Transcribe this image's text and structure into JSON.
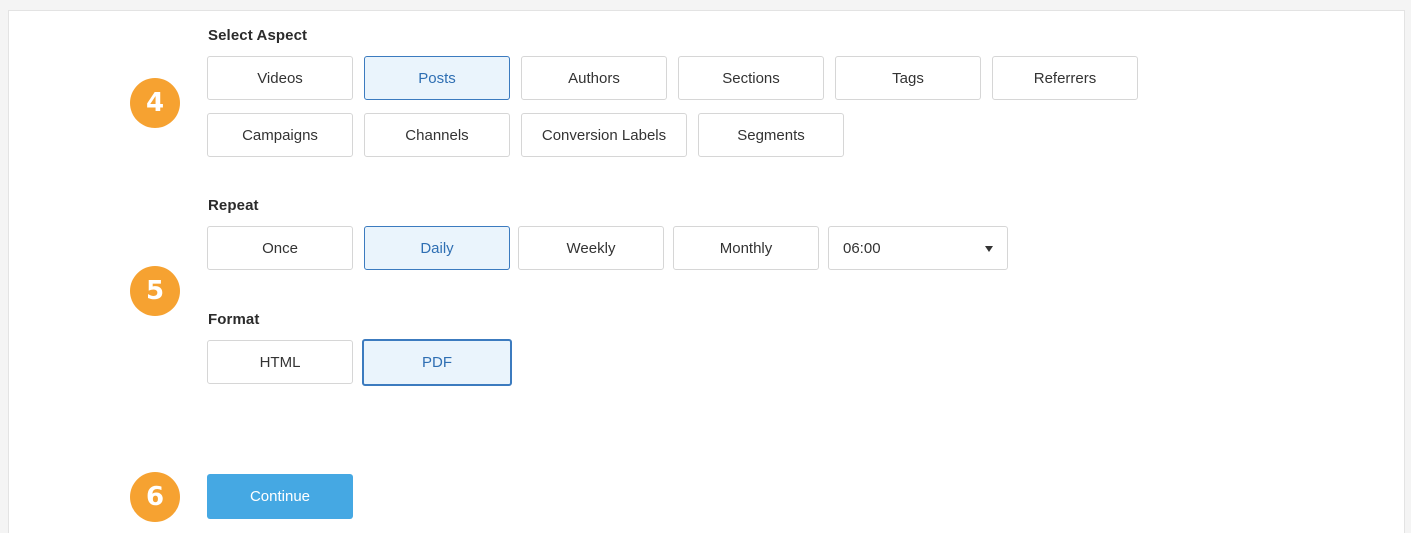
{
  "aspect": {
    "label": "Select Aspect",
    "options": [
      "Videos",
      "Posts",
      "Authors",
      "Sections",
      "Tags",
      "Referrers",
      "Campaigns",
      "Channels",
      "Conversion Labels",
      "Segments"
    ],
    "selected": "Posts"
  },
  "repeat": {
    "label": "Repeat",
    "options": [
      "Once",
      "Daily",
      "Weekly",
      "Monthly"
    ],
    "selected": "Daily",
    "time_value": "06:00"
  },
  "format": {
    "label": "Format",
    "options": [
      "HTML",
      "PDF"
    ],
    "selected": "PDF"
  },
  "steps": [
    "4",
    "5",
    "6"
  ],
  "actions": {
    "continue_label": "Continue"
  },
  "colors": {
    "accent": "#45a8e3",
    "badge": "#f6a231",
    "selected_border": "#3c7bbf",
    "selected_bg": "#eaf4fc"
  }
}
